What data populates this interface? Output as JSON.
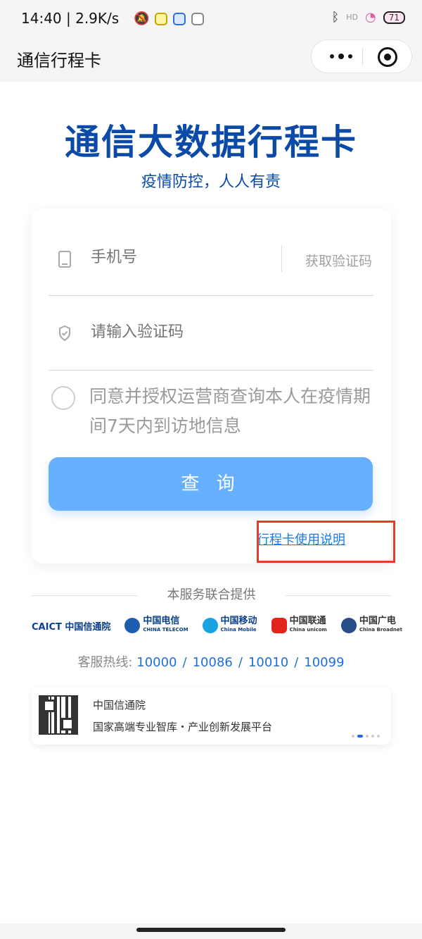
{
  "status_bar": {
    "time_speed": "14:40 | 2.9K/s",
    "hd_label": "HD",
    "battery_label": "71"
  },
  "nav": {
    "title": "通信行程卡"
  },
  "header": {
    "title": "通信大数据行程卡",
    "subtitle": "疫情防控，人人有责"
  },
  "form": {
    "phone_placeholder": "手机号",
    "get_code_label": "获取验证码",
    "code_placeholder": "请输入验证码",
    "agreement_text": "同意并授权运营商查询本人在疫情期间7天内到访地信息",
    "query_button": "查 询",
    "usage_link": "行程卡使用说明"
  },
  "providers": {
    "heading": "本服务联合提供",
    "logos": [
      "CAICT 中国信通院",
      "中国电信",
      "中国移动",
      "中国联通",
      "中国广电"
    ],
    "logo_sub": [
      "",
      "CHINA TELECOM",
      "China Mobile",
      "China unicom",
      "China Broadnet"
    ]
  },
  "hotline": {
    "label": "客服热线:",
    "numbers": [
      "10000",
      "10086",
      "10010",
      "10099"
    ]
  },
  "banner": {
    "org": "中国信通院",
    "slogan": "国家高端专业智库・产业创新发展平台"
  },
  "colors": {
    "brand_blue": "#0b4aa6",
    "button_blue": "#66b0ff",
    "link_blue": "#1f7ae0",
    "highlight_red": "#e83b28"
  }
}
